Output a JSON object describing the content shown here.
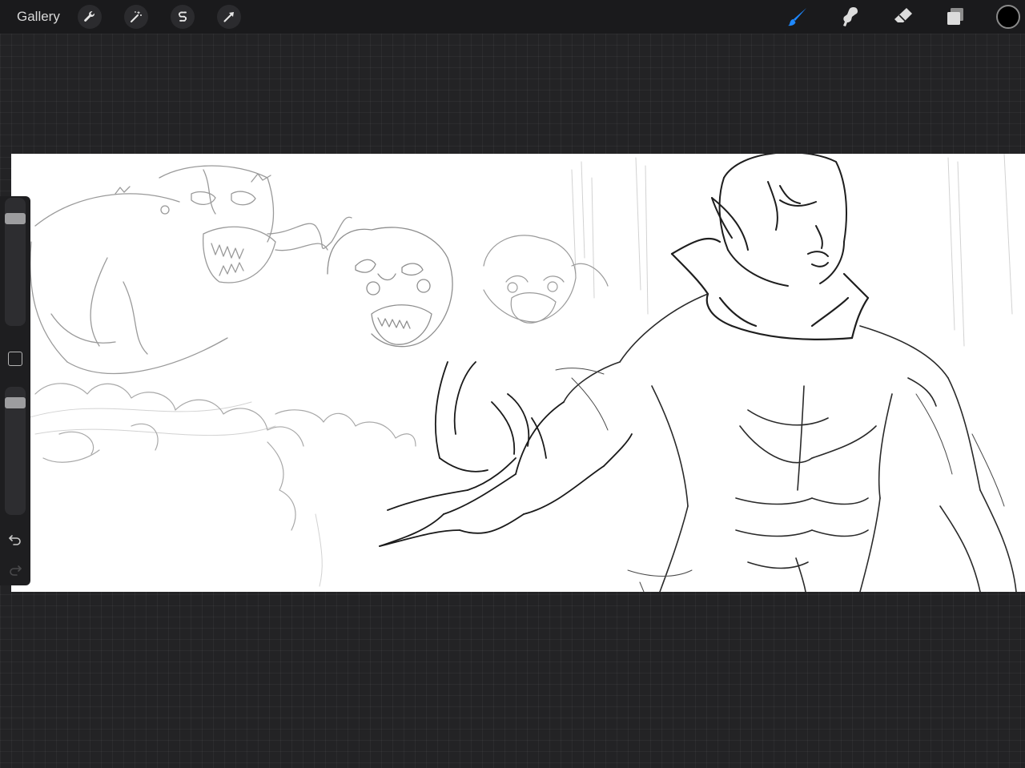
{
  "topbar": {
    "gallery_label": "Gallery",
    "left_tools": [
      "wrench-icon",
      "magic-wand-icon",
      "selection-s-icon",
      "transform-arrow-icon"
    ],
    "right_tools": [
      "brush-icon",
      "smudge-icon",
      "eraser-icon",
      "layers-icon"
    ],
    "active_tool": "brush-icon",
    "current_color": "#000000"
  },
  "sidebar": {
    "brush_size": 0.87,
    "brush_opacity": 0.91,
    "undo_enabled": true,
    "redo_enabled": false
  },
  "colors": {
    "accent": "#1e88ff",
    "workspace": "#232325",
    "toolbar": "#1a1a1c",
    "canvas": "#ffffff"
  }
}
